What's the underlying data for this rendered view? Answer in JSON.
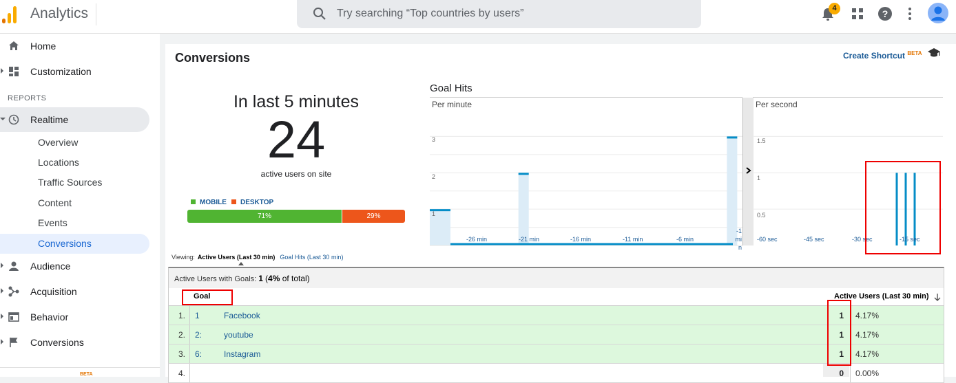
{
  "header": {
    "app_title": "Analytics",
    "search_placeholder": "Try searching “Top countries by users”",
    "notification_count": "4",
    "logo_colors": [
      "#f9ab00",
      "#e37400"
    ],
    "icons": [
      "analytics-logo-icon",
      "search-icon",
      "notifications-icon",
      "apps-grid-icon",
      "help-icon",
      "more-vert-icon",
      "account-avatar-icon"
    ]
  },
  "sidebar": {
    "top_items": [
      {
        "label": "Home",
        "icon": "home-icon"
      },
      {
        "label": "Customization",
        "icon": "dashboard-icon"
      }
    ],
    "reports_label": "REPORTS",
    "realtime": {
      "label": "Realtime",
      "icon": "clock-icon"
    },
    "realtime_sub": [
      "Overview",
      "Locations",
      "Traffic Sources",
      "Content",
      "Events",
      "Conversions"
    ],
    "active_sub": "Conversions",
    "bottom_items": [
      {
        "label": "Audience",
        "icon": "person-icon"
      },
      {
        "label": "Acquisition",
        "icon": "acquisition-icon"
      },
      {
        "label": "Behavior",
        "icon": "behavior-icon"
      },
      {
        "label": "Conversions",
        "icon": "flag-icon"
      }
    ],
    "beta_label": "BETA"
  },
  "main": {
    "title": "Conversions",
    "create_shortcut": "Create Shortcut",
    "beta": "BETA",
    "in_last": "In last 5 minutes",
    "active_count": "24",
    "active_label": "active users on site",
    "device_legend": [
      {
        "label": "MOBILE",
        "color": "#50b432"
      },
      {
        "label": "DESKTOP",
        "color": "#ed561b"
      }
    ],
    "device_split": [
      {
        "label": "71%",
        "share": 0.71,
        "color": "#50b432"
      },
      {
        "label": "29%",
        "share": 0.29,
        "color": "#ed561b"
      }
    ]
  },
  "chart_data": [
    {
      "type": "bar",
      "title": "Goal Hits",
      "label": "Per minute",
      "y_ticks": [
        "1",
        "2",
        "3"
      ],
      "x_ticks": [
        "-26 min",
        "-21 min",
        "-16 min",
        "-11 min",
        "-6 min",
        "-1 min"
      ],
      "x": [
        -30,
        -21,
        -1
      ],
      "values": [
        1,
        2,
        3
      ],
      "ylim": [
        0,
        3.5
      ]
    },
    {
      "type": "bar",
      "label": "Per second",
      "y_ticks": [
        "0.5",
        "1",
        "1.5"
      ],
      "x_ticks": [
        "-60 sec",
        "-45 sec",
        "-30 sec",
        "-15 sec"
      ],
      "x": [
        -15,
        -12,
        -9
      ],
      "values": [
        1,
        1,
        1
      ],
      "ylim": [
        0,
        1.75
      ]
    }
  ],
  "viewing": {
    "label": "Viewing:",
    "active_tab": "Active Users (Last 30 min)",
    "other_tab": "Goal Hits (Last 30 min)"
  },
  "table": {
    "summary_label": "Active Users with Goals:",
    "summary_count": "1",
    "summary_pct": "4%",
    "summary_paren_open": "(",
    "summary_suffix": " of total)",
    "col_goal": "Goal",
    "col_active": "Active Users (Last 30 min)",
    "rows": [
      {
        "num": "1.",
        "idx": "1",
        "name": "Facebook",
        "value": "1",
        "pct": "4.17%"
      },
      {
        "num": "2.",
        "idx": "2:",
        "name": "youtube",
        "value": "1",
        "pct": "4.17%"
      },
      {
        "num": "3.",
        "idx": "6:",
        "name": "Instagram",
        "value": "1",
        "pct": "4.17%"
      },
      {
        "num": "4.",
        "idx": "",
        "name": "",
        "value": "0",
        "pct": "0.00%"
      }
    ]
  }
}
